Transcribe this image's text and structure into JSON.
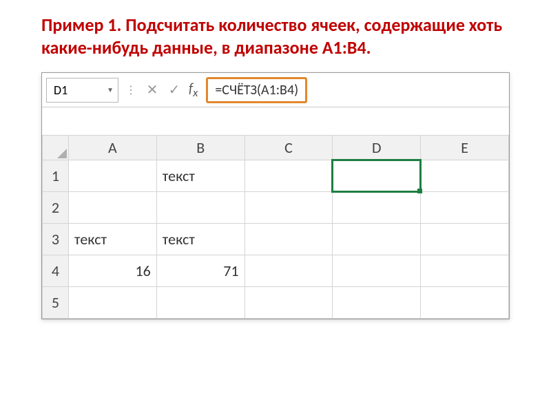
{
  "title": "Пример 1. Подсчитать количество ячеек, содержащие хоть какие-нибудь данные, в диапазоне А1:В4.",
  "namebox": "D1",
  "formula": "=СЧЁТЗ(A1:B4)",
  "columns": [
    "A",
    "B",
    "C",
    "D",
    "E"
  ],
  "rows": [
    "1",
    "2",
    "3",
    "4",
    "5"
  ],
  "cells": {
    "B1": "текст",
    "A3": "текст",
    "B3": "текст",
    "A4": "16",
    "B4": "71"
  },
  "icons": {
    "dropdown": "▼",
    "sep": "⋮",
    "cancel": "✕",
    "confirm": "✓"
  }
}
